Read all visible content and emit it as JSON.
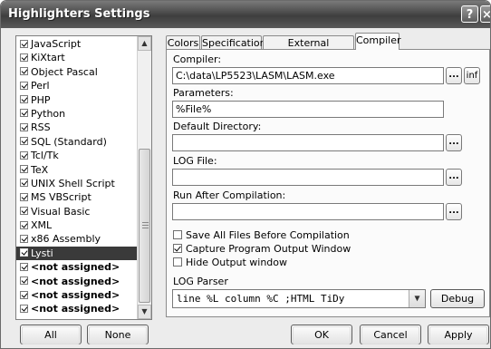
{
  "window": {
    "title": "Highlighters Settings",
    "help_label": "?",
    "close_label": "×"
  },
  "languages": [
    {
      "label": "JavaScript",
      "checked": true
    },
    {
      "label": "KiXtart",
      "checked": true
    },
    {
      "label": "Object Pascal",
      "checked": true
    },
    {
      "label": "Perl",
      "checked": true
    },
    {
      "label": "PHP",
      "checked": true
    },
    {
      "label": "Python",
      "checked": true
    },
    {
      "label": "RSS",
      "checked": true
    },
    {
      "label": "SQL (Standard)",
      "checked": true
    },
    {
      "label": "Tcl/Tk",
      "checked": true
    },
    {
      "label": "TeX",
      "checked": true
    },
    {
      "label": "UNIX Shell Script",
      "checked": true
    },
    {
      "label": "MS VBScript",
      "checked": true
    },
    {
      "label": "Visual Basic",
      "checked": true
    },
    {
      "label": "XML",
      "checked": true
    },
    {
      "label": "x86 Assembly",
      "checked": true
    },
    {
      "label": "Lysti",
      "checked": true,
      "selected": true
    },
    {
      "label": "<not assigned>",
      "checked": true,
      "bold": true
    },
    {
      "label": "<not assigned>",
      "checked": true,
      "bold": true
    },
    {
      "label": "<not assigned>",
      "checked": true,
      "bold": true
    },
    {
      "label": "<not assigned>",
      "checked": true,
      "bold": true
    }
  ],
  "tabs": {
    "colors": "Colors",
    "specification": "Specification",
    "external": "External applications",
    "compiler": "Compiler",
    "active": "Compiler"
  },
  "compiler": {
    "compiler_label": "Compiler:",
    "compiler_value": "C:\\data\\LP5523\\LASM\\LASM.exe",
    "inf_label": "inf",
    "browse_label": "...",
    "parameters_label": "Parameters:",
    "parameters_value": "%File%",
    "default_dir_label": "Default Directory:",
    "default_dir_value": "",
    "log_file_label": "LOG File:",
    "log_file_value": "",
    "run_after_label": "Run After Compilation:",
    "run_after_value": "",
    "save_all_label": "Save All Files Before Compilation",
    "save_all_checked": false,
    "capture_label": "Capture Program Output Window",
    "capture_checked": true,
    "hide_output_label": "Hide Output window",
    "hide_output_checked": false,
    "log_parser_label": "LOG Parser",
    "log_parser_value": "line %L column %C ;HTML TiDy",
    "debug_label": "Debug"
  },
  "footer": {
    "all_label": "All",
    "none_label": "None",
    "ok_label": "OK",
    "cancel_label": "Cancel",
    "apply_label": "Apply"
  }
}
